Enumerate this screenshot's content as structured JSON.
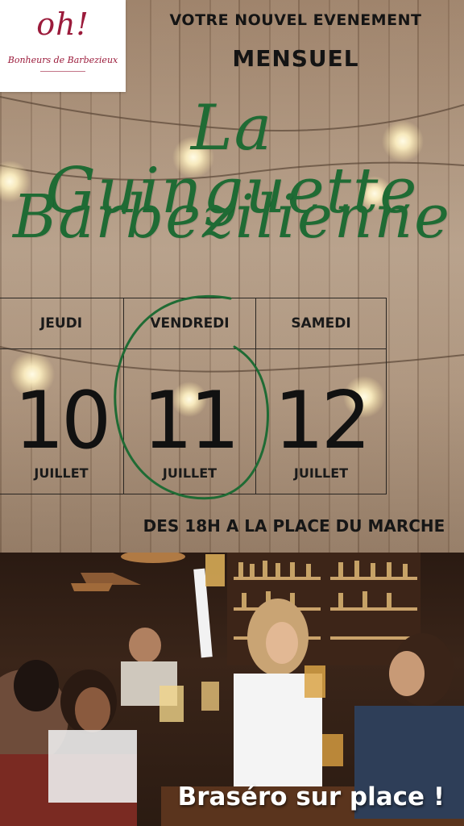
{
  "logo": {
    "mark": "oh!",
    "brand": "Bonheurs de Barbezieux"
  },
  "header": {
    "line1": "VOTRE NOUVEL EVENEMENT",
    "line2": "MENSUEL"
  },
  "title": {
    "line1": "La Guinguette",
    "line2": "Barbezilienne"
  },
  "calendar": {
    "days": [
      {
        "name": "JEUDI",
        "number": "10",
        "month": "JUILLET"
      },
      {
        "name": "VENDREDI",
        "number": "11",
        "month": "JUILLET"
      },
      {
        "name": "SAMEDI",
        "number": "12",
        "month": "JUILLET"
      }
    ]
  },
  "schedule": "DES 18H A LA PLACE DU MARCHE",
  "footer": {
    "note": "Braséro sur place !"
  },
  "colors": {
    "title_green": "#1f6b34",
    "logo_red": "#9b1b3b",
    "circle_green": "#1f6b34"
  },
  "icons": [
    "string-lights-icon",
    "circle-highlight-icon"
  ]
}
